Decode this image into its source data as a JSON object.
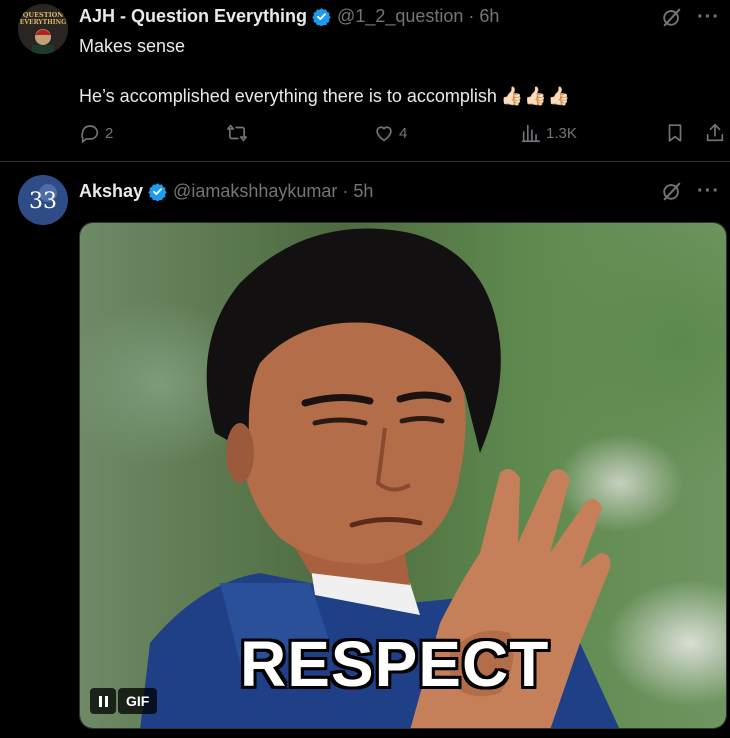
{
  "tweets": [
    {
      "avatar_text": "QUESTION EVERYTHING",
      "name": "AJH - Question Everything",
      "handle": "@1_2_question",
      "separator": "·",
      "time": "6h",
      "text_line1": "Makes sense",
      "text_line2": "He’s accomplished everything there is to accomplish",
      "emoji": "👍🏻👍🏻👍🏻",
      "replies": "2",
      "likes": "4",
      "views": "1.3K"
    },
    {
      "avatar_text": "33",
      "name": "Akshay",
      "handle": "@iamakshhaykumar",
      "separator": "·",
      "time": "5h",
      "media": {
        "caption": "RESPECT",
        "gif_label": "GIF"
      }
    }
  ],
  "more_label": "···",
  "colors": {
    "background": "#000000",
    "text": "#e7e9ea",
    "muted": "#71767b",
    "verified": "#1d9bf0",
    "divider": "#2f3336"
  },
  "icons": [
    "grok-icon",
    "more-icon",
    "reply-icon",
    "retweet-icon",
    "like-icon",
    "views-icon",
    "bookmark-icon",
    "share-icon",
    "verified-badge-icon",
    "pause-icon"
  ]
}
